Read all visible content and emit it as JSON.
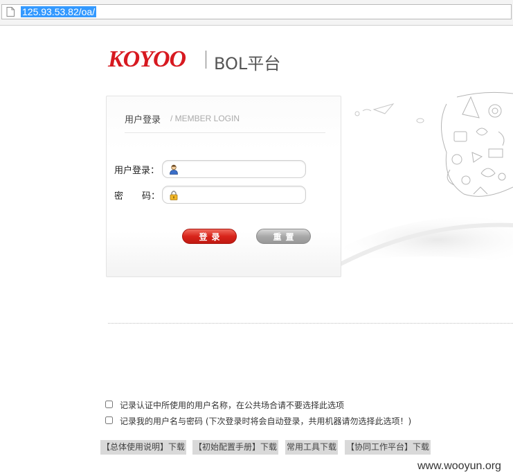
{
  "browser": {
    "url": "125.93.53.82/oa/"
  },
  "header": {
    "brand": "KOYOO",
    "platform": "BOL平台"
  },
  "login": {
    "title": "用户登录",
    "subtitle": "/ MEMBER LOGIN",
    "username_label": "用户登录：",
    "password_label_a": "密",
    "password_label_b": "码：",
    "username_value": "",
    "password_value": "",
    "login_button": "登录",
    "reset_button": "重置"
  },
  "options": [
    {
      "label": "记录认证中所使用的用户名称，在公共场合请不要选择此选项",
      "checked": false
    },
    {
      "label": "记录我的用户名与密码 (下次登录时将会自动登录，共用机器请勿选择此选项！)",
      "checked": false
    }
  ],
  "downloads": [
    "【总体使用说明】下载",
    "【初始配置手册】下载",
    "常用工具下载",
    "【协同工作平台】下载"
  ],
  "watermark": "www.wooyun.org",
  "colors": {
    "brand_red": "#d71920",
    "login_button": "#d8241a",
    "reset_button": "#a9a9a9",
    "selection": "#3399ff"
  },
  "icons": {
    "username": "user-icon",
    "password": "lock-icon",
    "tab": "page-icon"
  }
}
